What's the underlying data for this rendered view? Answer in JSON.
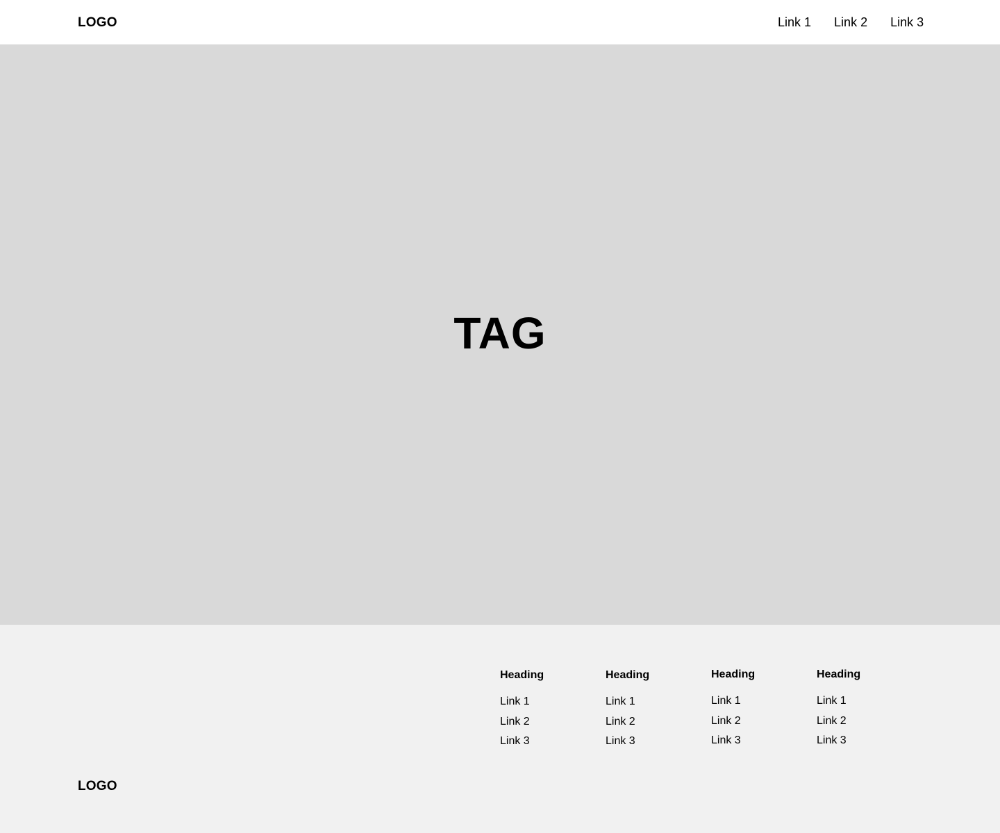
{
  "header": {
    "logo": "LOGO",
    "links": [
      "Link 1",
      "Link 2",
      "Link 3"
    ]
  },
  "hero": {
    "tag": "TAG",
    "background": "#d9d9d9"
  },
  "footer": {
    "background": "#f1f1f1",
    "columns": [
      {
        "heading": "Heading",
        "links": [
          "Link 1",
          "Link 2",
          "Link 3"
        ]
      },
      {
        "heading": "Heading",
        "links": [
          "Link 1",
          "Link 2",
          "Link 3"
        ]
      },
      {
        "heading": "Heading",
        "links": [
          "Link 1",
          "Link 2",
          "Link 3"
        ]
      },
      {
        "heading": "Heading",
        "links": [
          "Link 1",
          "Link 2",
          "Link 3"
        ]
      }
    ],
    "logo": "LOGO"
  }
}
